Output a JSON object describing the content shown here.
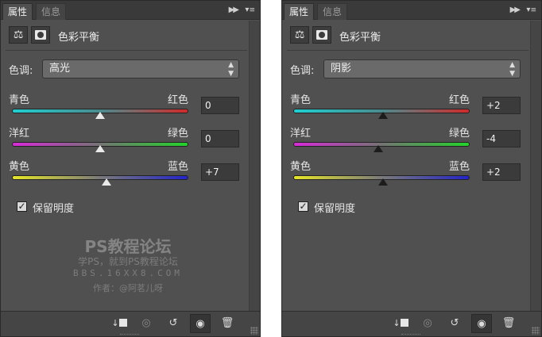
{
  "panels": [
    {
      "tabs": [
        "属性",
        "信息"
      ],
      "title": "色彩平衡",
      "tone_label": "色调:",
      "tone_value": "高光",
      "sliders": [
        {
          "left": "青色",
          "right": "红色",
          "value": "0",
          "level": 0
        },
        {
          "left": "洋红",
          "right": "绿色",
          "value": "0",
          "level": 0
        },
        {
          "left": "黄色",
          "right": "蓝色",
          "value": "+7",
          "level": 7
        }
      ],
      "preserve_label": "保留明度",
      "preserve_checked": true,
      "watermark": {
        "line1": "PS教程论坛",
        "line2": "学PS，就到PS教程论坛",
        "line3": "BBS.16XX8.COM",
        "line4": "作者：@阿茗儿呀"
      }
    },
    {
      "tabs": [
        "属性",
        "信息"
      ],
      "title": "色彩平衡",
      "tone_label": "色调:",
      "tone_value": "阴影",
      "sliders": [
        {
          "left": "青色",
          "right": "红色",
          "value": "+2",
          "level": 2
        },
        {
          "left": "洋红",
          "right": "绿色",
          "value": "-4",
          "level": -4
        },
        {
          "left": "黄色",
          "right": "蓝色",
          "value": "+2",
          "level": 2
        }
      ],
      "preserve_label": "保留明度",
      "preserve_checked": true
    }
  ],
  "icons": {
    "tab_controls": [
      "fast-forward-icon",
      "panel-menu-icon"
    ],
    "header": [
      "balance-scale-icon",
      "layer-mask-icon"
    ],
    "bottom": [
      "clip-to-layer-icon",
      "view-previous-state-icon",
      "reset-icon",
      "visibility-eye-icon",
      "trash-icon"
    ]
  },
  "colors": {
    "panel_bg": "#505050",
    "cyan": "#1fd0d2",
    "red": "#d12a2a",
    "magenta": "#d92ad9",
    "green": "#23d32a",
    "yellow": "#e7e628",
    "blue": "#2424c9"
  }
}
